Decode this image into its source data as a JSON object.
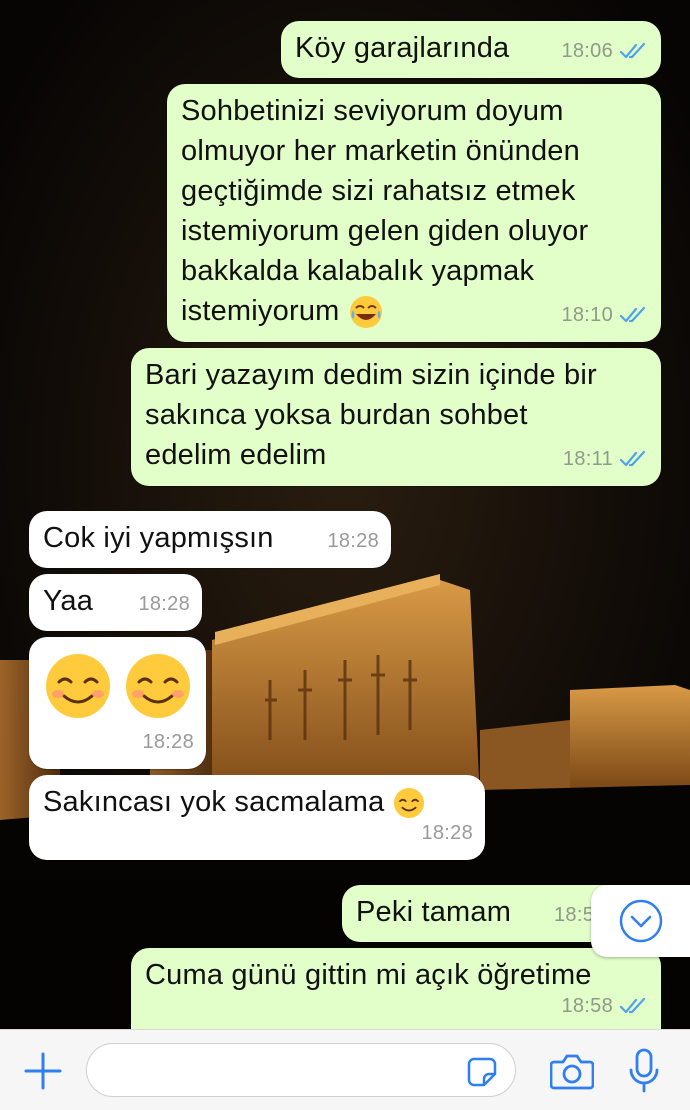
{
  "chat": {
    "messages": [
      {
        "direction": "out",
        "text": "Köy garajlarında",
        "time": "18:06",
        "status": "read"
      },
      {
        "direction": "out",
        "text": "Sohbetinizi seviyorum doyum\nolmuyor her marketin önünden\ngeçtiğimde sizi rahatsız etmek\nistemiyorum gelen giden oluyor\nbakkalda kalabalık yapmak\nistemiyorum",
        "emoji": "face-with-tears-of-joy",
        "time": "18:10",
        "status": "read"
      },
      {
        "direction": "out",
        "text": "Bari yazayım dedim sizin içinde bir\nsakınca yoksa burdan sohbet\nedelim  edelim",
        "time": "18:11",
        "status": "read"
      },
      {
        "direction": "in",
        "text": "Cok iyi yapmışsın",
        "time": "18:28"
      },
      {
        "direction": "in",
        "text": "Yaa",
        "time": "18:28"
      },
      {
        "direction": "in",
        "text": "",
        "emoji": "smiling-face x2",
        "time": "18:28"
      },
      {
        "direction": "in",
        "text": "Sakıncası yok sacmalama",
        "emoji": "smiling-face",
        "time": "18:28"
      },
      {
        "direction": "out",
        "text": "Peki tamam",
        "time": "18:5",
        "status": "read"
      },
      {
        "direction": "out",
        "text": "Cuma günü gittin mi açık öğretime",
        "time": "18:58",
        "status": "read"
      }
    ]
  },
  "input_bar": {
    "placeholder": "",
    "icons": [
      "plus-icon",
      "sticker-icon",
      "camera-icon",
      "microphone-icon"
    ]
  },
  "colors": {
    "outgoing_bubble": "#e2fec9",
    "incoming_bubble": "#ffffff",
    "read_tick": "#4fa3e8",
    "accent": "#2f7ff0"
  }
}
